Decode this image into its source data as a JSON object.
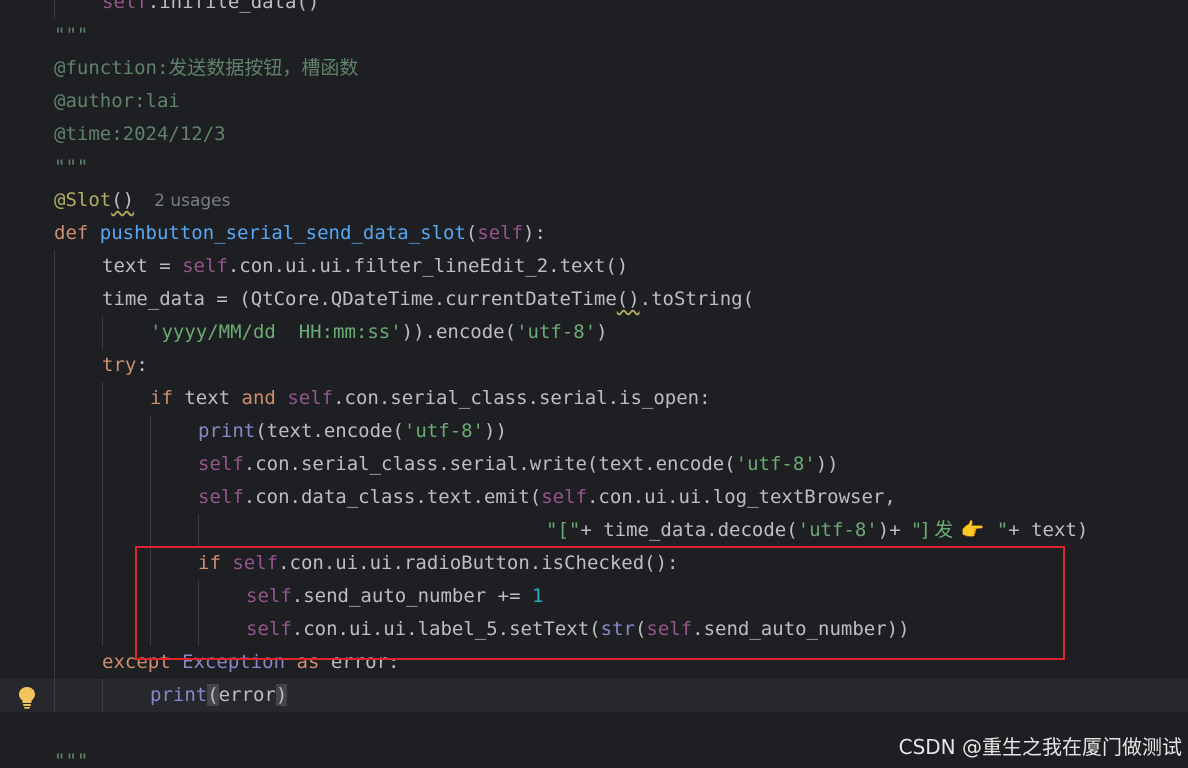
{
  "code": {
    "l1_self": "self",
    "l1_rest": ".inifile_data()",
    "l2_docquote": "\"\"\"",
    "l3_tag": "@function:",
    "l3_text": "发送数据按钮，槽函数",
    "l4_doc": "@author:lai",
    "l5_doc": "@time:2024/12/3",
    "l6_docquote": "\"\"\"",
    "l7_decorator": "@Slot",
    "l7_parens": "()",
    "l7_hint": "2 usages",
    "l8_def": "def",
    "l8_fn": "pushbutton_serial_send_data_slot",
    "l8_self": "self",
    "l9_a": "text = ",
    "l9_self": "self",
    "l9_b": ".con.ui.ui.filter_lineEdit_2.text()",
    "l10_a": "time_data = (QtCore.QDateTime.currentDateTime",
    "l10_parens": "()",
    "l10_b": ".toString(",
    "l11_str": "'yyyy/MM/dd  HH:mm:ss'",
    "l11_b": ")).encode(",
    "l11_str2": "'utf-8'",
    "l11_c": ")",
    "l12_try": "try",
    "l12_colon": ":",
    "l13_if": "if",
    "l13_a": " text ",
    "l13_and": "and",
    "l13_self": "self",
    "l13_b": ".con.serial_class.serial.is_open:",
    "l14_print": "print",
    "l14_a": "(text.encode(",
    "l14_str": "'utf-8'",
    "l14_b": "))",
    "l15_self": "self",
    "l15_a": ".con.serial_class.serial.write(text.encode(",
    "l15_str": "'utf-8'",
    "l15_b": "))",
    "l16_self": "self",
    "l16_a": ".con.data_class.text.emit(",
    "l16_self2": "self",
    "l16_b": ".con.ui.ui.log_textBrowser,",
    "l17_str1": "\"[\"",
    "l17_a": "+ time_data.decode(",
    "l17_str2": "'utf-8'",
    "l17_b": ")+ ",
    "l17_str3a": "\"] 发 ",
    "l17_emoji": "👉",
    "l17_str3b": " \"",
    "l17_c": "+ text)",
    "l18_if": "if",
    "l18_self": "self",
    "l18_a": ".con.ui.ui.radioButton.isChecked():",
    "l19_self": "self",
    "l19_a": ".send_auto_number += ",
    "l19_num": "1",
    "l20_self": "self",
    "l20_a": ".con.ui.ui.label_5.setText(",
    "l20_str": "str",
    "l20_b": "(",
    "l20_self2": "self",
    "l20_c": ".send_auto_number))",
    "l21_except": "except",
    "l21_exc": "Exception",
    "l21_as": "as",
    "l21_a": " error:",
    "l22_print": "print",
    "l22_a": "(",
    "l22_b": "error",
    "l22_c": ")",
    "l24_docquote": "\"\"\""
  },
  "gutter": {
    "icon": "lightbulb-icon"
  },
  "highlight": {
    "color": "#e0232c"
  },
  "watermark": {
    "text": "CSDN @重生之我在厦门做测试"
  }
}
